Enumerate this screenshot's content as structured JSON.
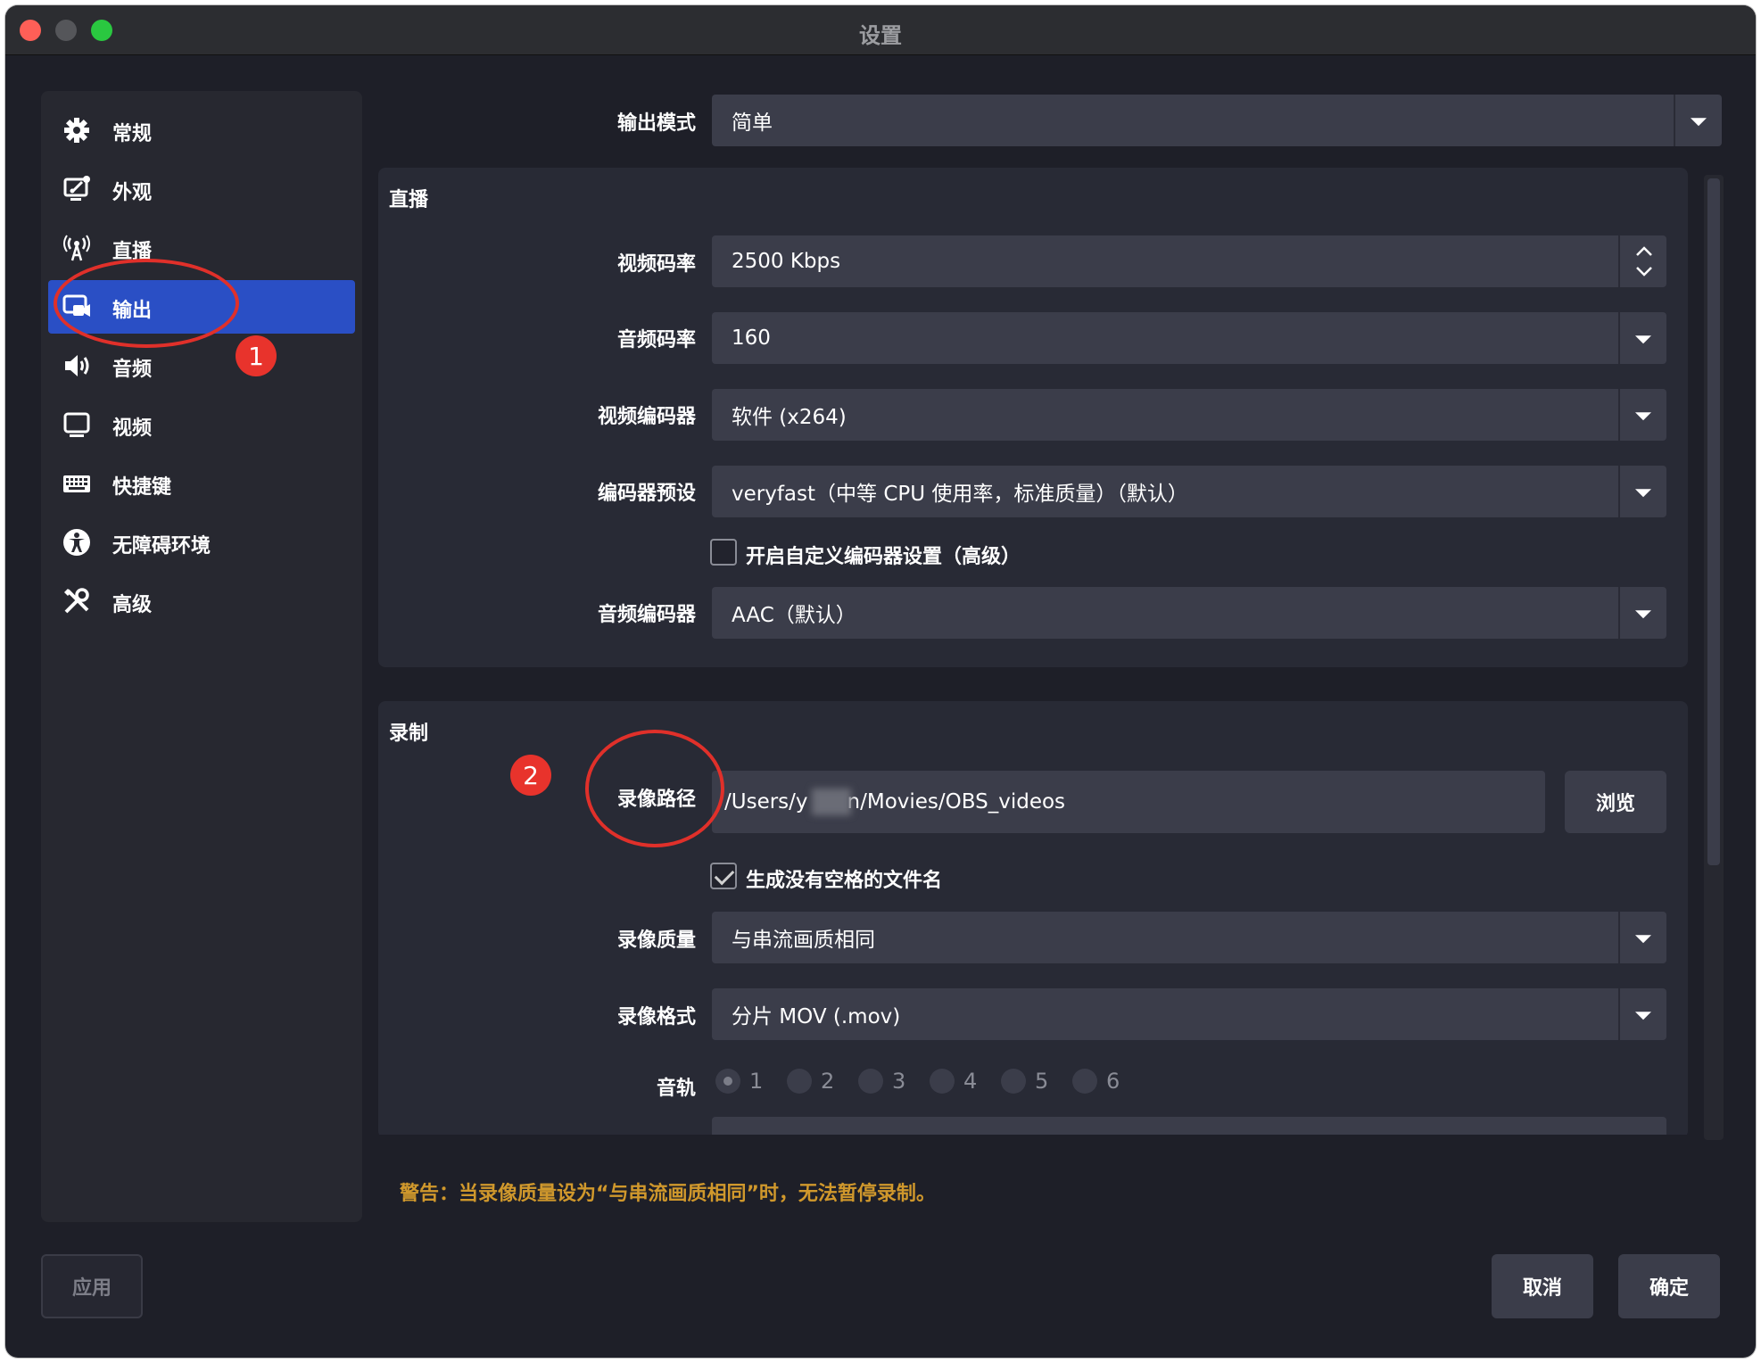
{
  "window": {
    "title": "设置"
  },
  "sidebar": {
    "items": [
      {
        "label": "常规",
        "icon": "gear-icon",
        "active": false
      },
      {
        "label": "外观",
        "icon": "appearance-icon",
        "active": false
      },
      {
        "label": "直播",
        "icon": "antenna-icon",
        "active": false
      },
      {
        "label": "输出",
        "icon": "output-icon",
        "active": true
      },
      {
        "label": "音频",
        "icon": "speaker-icon",
        "active": false
      },
      {
        "label": "视频",
        "icon": "monitor-icon",
        "active": false
      },
      {
        "label": "快捷键",
        "icon": "keyboard-icon",
        "active": false
      },
      {
        "label": "无障碍环境",
        "icon": "accessibility-icon",
        "active": false
      },
      {
        "label": "高级",
        "icon": "tools-icon",
        "active": false
      }
    ]
  },
  "output_mode": {
    "label": "输出模式",
    "value": "简单"
  },
  "streaming": {
    "title": "直播",
    "video_bitrate": {
      "label": "视频码率",
      "value": "2500 Kbps"
    },
    "audio_bitrate": {
      "label": "音频码率",
      "value": "160"
    },
    "video_encoder": {
      "label": "视频编码器",
      "value": "软件 (x264)"
    },
    "encoder_preset": {
      "label": "编码器预设",
      "value": "veryfast（中等 CPU 使用率，标准质量）（默认）"
    },
    "custom_encoder": {
      "label": "开启自定义编码器设置（高级）",
      "checked": false
    },
    "audio_encoder": {
      "label": "音频编码器",
      "value": "AAC（默认）"
    }
  },
  "recording": {
    "title": "录制",
    "path": {
      "label": "录像路径",
      "value_start": "/Users/y",
      "value_end": "n/Movies/OBS_videos",
      "browse_label": "浏览"
    },
    "no_spaces": {
      "label": "生成没有空格的文件名",
      "checked": true
    },
    "quality": {
      "label": "录像质量",
      "value": "与串流画质相同"
    },
    "format": {
      "label": "录像格式",
      "value": "分片 MOV (.mov)"
    },
    "audio_track": {
      "label": "音轨",
      "tracks": [
        "1",
        "2",
        "3",
        "4",
        "5",
        "6"
      ],
      "selected": "1"
    }
  },
  "warning": "警告：当录像质量设为“与串流画质相同”时，无法暂停录制。",
  "footer": {
    "apply_label": "应用",
    "cancel_label": "取消",
    "ok_label": "确定"
  },
  "annotations": {
    "badge_1": "1",
    "badge_2": "2",
    "annotation_color": "#e0302a"
  },
  "colors": {
    "accent": "#2a4fc5",
    "warning": "#d0982c",
    "background": "#1e1f28"
  }
}
